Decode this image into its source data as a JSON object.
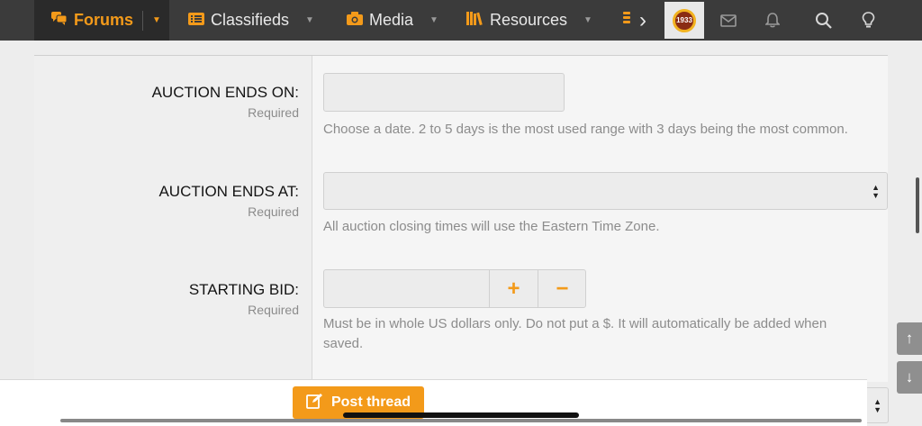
{
  "nav": {
    "tabs": [
      {
        "label": "Forums",
        "icon": "comments-icon"
      },
      {
        "label": "Classifieds",
        "icon": "list-icon"
      },
      {
        "label": "Media",
        "icon": "camera-icon"
      },
      {
        "label": "Resources",
        "icon": "books-icon"
      }
    ],
    "more_icon": "coins-icon",
    "right_icons": [
      "avatar",
      "envelope-icon",
      "bell-icon",
      "search-icon",
      "lightbulb-icon"
    ],
    "avatar_text": "1933"
  },
  "form": {
    "auction_ends_on": {
      "label": "AUCTION ENDS ON:",
      "required": "Required",
      "hint": "Choose a date. 2 to 5 days is the most used range with 3 days being the most common."
    },
    "auction_ends_at": {
      "label": "AUCTION ENDS AT:",
      "required": "Required",
      "hint": "All auction closing times will use the Eastern Time Zone."
    },
    "starting_bid": {
      "label": "STARTING BID:",
      "required": "Required",
      "hint_line1": "Must be in whole US dollars only. Do not put a $. It will automatically be added when",
      "hint_line2": "saved.",
      "plus": "+",
      "minus": "−"
    }
  },
  "bottom": {
    "post_thread_label": "Post thread"
  },
  "colors": {
    "accent": "#f39a1a",
    "nav_bg": "#3b3b3b"
  }
}
